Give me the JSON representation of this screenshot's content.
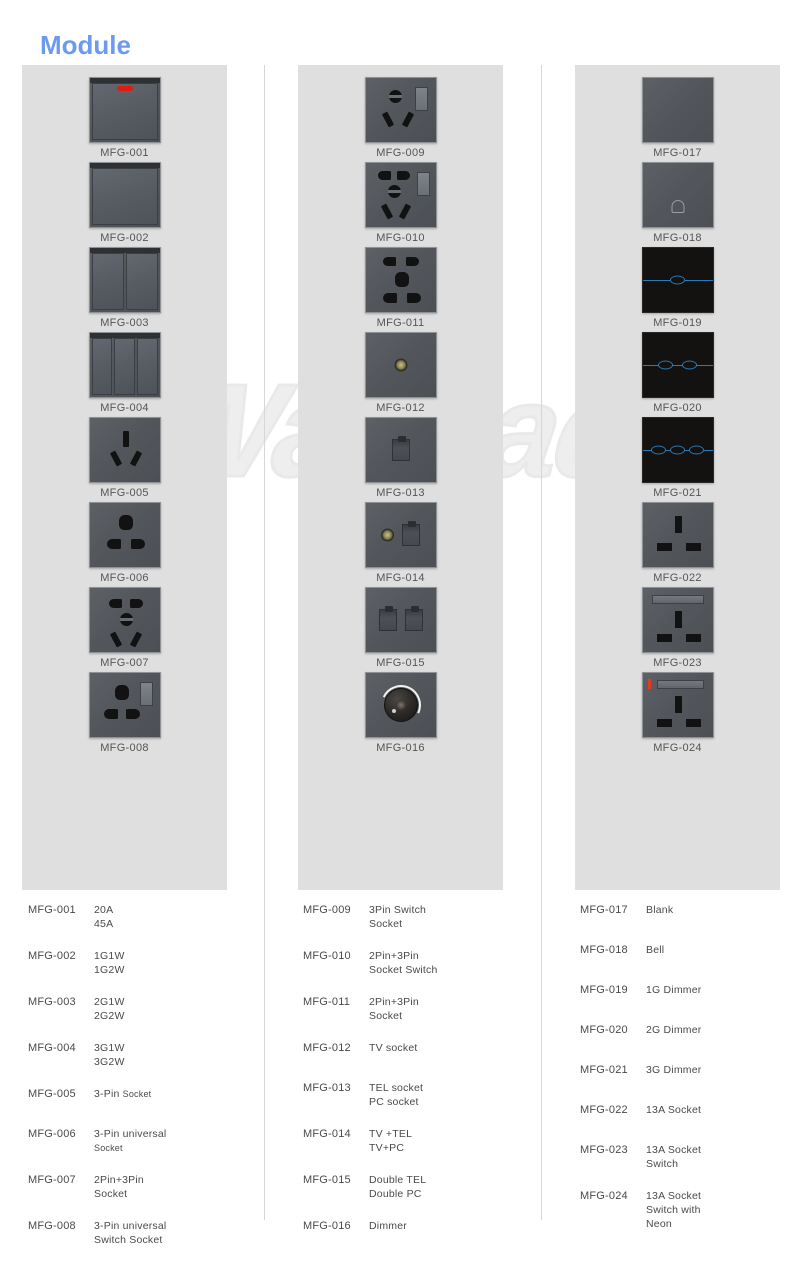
{
  "page": {
    "title": "Module",
    "watermark": "Wallpad",
    "accent_color": "#6c9bee",
    "panel_color": "#dfdfdf",
    "text_color": "#4a4a4a",
    "device_face_color": "#54585d",
    "dark_face_color": "#141210",
    "led_color": "#e01c10",
    "touch_line_color": "#2b7bb9"
  },
  "columns": [
    {
      "id": "column-1",
      "products": [
        {
          "code": "MFG-001",
          "icon": "switch-1gang-with-red-led"
        },
        {
          "code": "MFG-002",
          "icon": "switch-1gang-blank-rocker"
        },
        {
          "code": "MFG-003",
          "icon": "switch-2gang-rocker"
        },
        {
          "code": "MFG-004",
          "icon": "switch-3gang-rocker"
        },
        {
          "code": "MFG-005",
          "icon": "socket-3pin-au"
        },
        {
          "code": "MFG-006",
          "icon": "socket-3pin-universal"
        },
        {
          "code": "MFG-007",
          "icon": "socket-2pin-plus-3pin"
        },
        {
          "code": "MFG-008",
          "icon": "socket-3pin-universal-with-switch"
        }
      ],
      "legend": [
        {
          "code": "MFG-001",
          "lines": [
            "20A",
            "45A"
          ]
        },
        {
          "code": "MFG-002",
          "lines": [
            "1G1W",
            "1G2W"
          ]
        },
        {
          "code": "MFG-003",
          "lines": [
            "2G1W",
            "2G2W"
          ]
        },
        {
          "code": "MFG-004",
          "lines": [
            "3G1W",
            "3G2W"
          ]
        },
        {
          "code": "MFG-005",
          "lines": [
            "3-Pin ",
            "Socket"
          ],
          "inline_small": true
        },
        {
          "code": "MFG-006",
          "lines": [
            "3-Pin universal",
            "Socket"
          ],
          "small_second": true
        },
        {
          "code": "MFG-007",
          "lines": [
            "2Pin+3Pin",
            "Socket"
          ]
        },
        {
          "code": "MFG-008",
          "lines": [
            "3-Pin universal",
            "Switch Socket"
          ]
        }
      ]
    },
    {
      "id": "column-2",
      "products": [
        {
          "code": "MFG-009",
          "icon": "socket-3pin-switched"
        },
        {
          "code": "MFG-010",
          "icon": "socket-2pin-3pin-switched"
        },
        {
          "code": "MFG-011",
          "icon": "socket-2pin-plus-3pin-universal"
        },
        {
          "code": "MFG-012",
          "icon": "tv-coax-socket"
        },
        {
          "code": "MFG-013",
          "icon": "telephone-rj-socket"
        },
        {
          "code": "MFG-014",
          "icon": "tv-plus-telephone-socket"
        },
        {
          "code": "MFG-015",
          "icon": "double-rj-socket"
        },
        {
          "code": "MFG-016",
          "icon": "rotary-dimmer-knob"
        }
      ],
      "legend": [
        {
          "code": "MFG-009",
          "lines": [
            "3Pin Switch",
            "Socket"
          ]
        },
        {
          "code": "MFG-010",
          "lines": [
            "2Pin+3Pin",
            "Socket Switch"
          ]
        },
        {
          "code": "MFG-011",
          "lines": [
            "2Pin+3Pin",
            "Socket"
          ]
        },
        {
          "code": "MFG-012",
          "lines": [
            "TV socket"
          ]
        },
        {
          "code": "MFG-013",
          "lines": [
            "TEL socket",
            "PC socket"
          ]
        },
        {
          "code": "MFG-014",
          "lines": [
            "TV +TEL",
            "TV+PC"
          ]
        },
        {
          "code": "MFG-015",
          "lines": [
            "Double TEL",
            "Double PC"
          ]
        },
        {
          "code": "MFG-016",
          "lines": [
            "Dimmer"
          ]
        }
      ]
    },
    {
      "id": "column-3",
      "products": [
        {
          "code": "MFG-017",
          "icon": "blank-plate"
        },
        {
          "code": "MFG-018",
          "icon": "bell-push-switch"
        },
        {
          "code": "MFG-019",
          "icon": "touch-dimmer-1gang"
        },
        {
          "code": "MFG-020",
          "icon": "touch-dimmer-2gang"
        },
        {
          "code": "MFG-021",
          "icon": "touch-dimmer-3gang"
        },
        {
          "code": "MFG-022",
          "icon": "socket-13a-uk"
        },
        {
          "code": "MFG-023",
          "icon": "socket-13a-uk-switched"
        },
        {
          "code": "MFG-024",
          "icon": "socket-13a-uk-switched-neon"
        }
      ],
      "legend": [
        {
          "code": "MFG-017",
          "lines": [
            "Blank"
          ]
        },
        {
          "code": "MFG-018",
          "lines": [
            "Bell"
          ]
        },
        {
          "code": "MFG-019",
          "lines": [
            "1G Dimmer"
          ]
        },
        {
          "code": "MFG-020",
          "lines": [
            "2G Dimmer"
          ]
        },
        {
          "code": "MFG-021",
          "lines": [
            "3G Dimmer"
          ]
        },
        {
          "code": "MFG-022",
          "lines": [
            "13A Socket"
          ]
        },
        {
          "code": "MFG-023",
          "lines": [
            "13A Socket",
            "Switch"
          ]
        },
        {
          "code": "MFG-024",
          "lines": [
            "13A Socket",
            "Switch with",
            "Neon"
          ]
        }
      ]
    }
  ]
}
